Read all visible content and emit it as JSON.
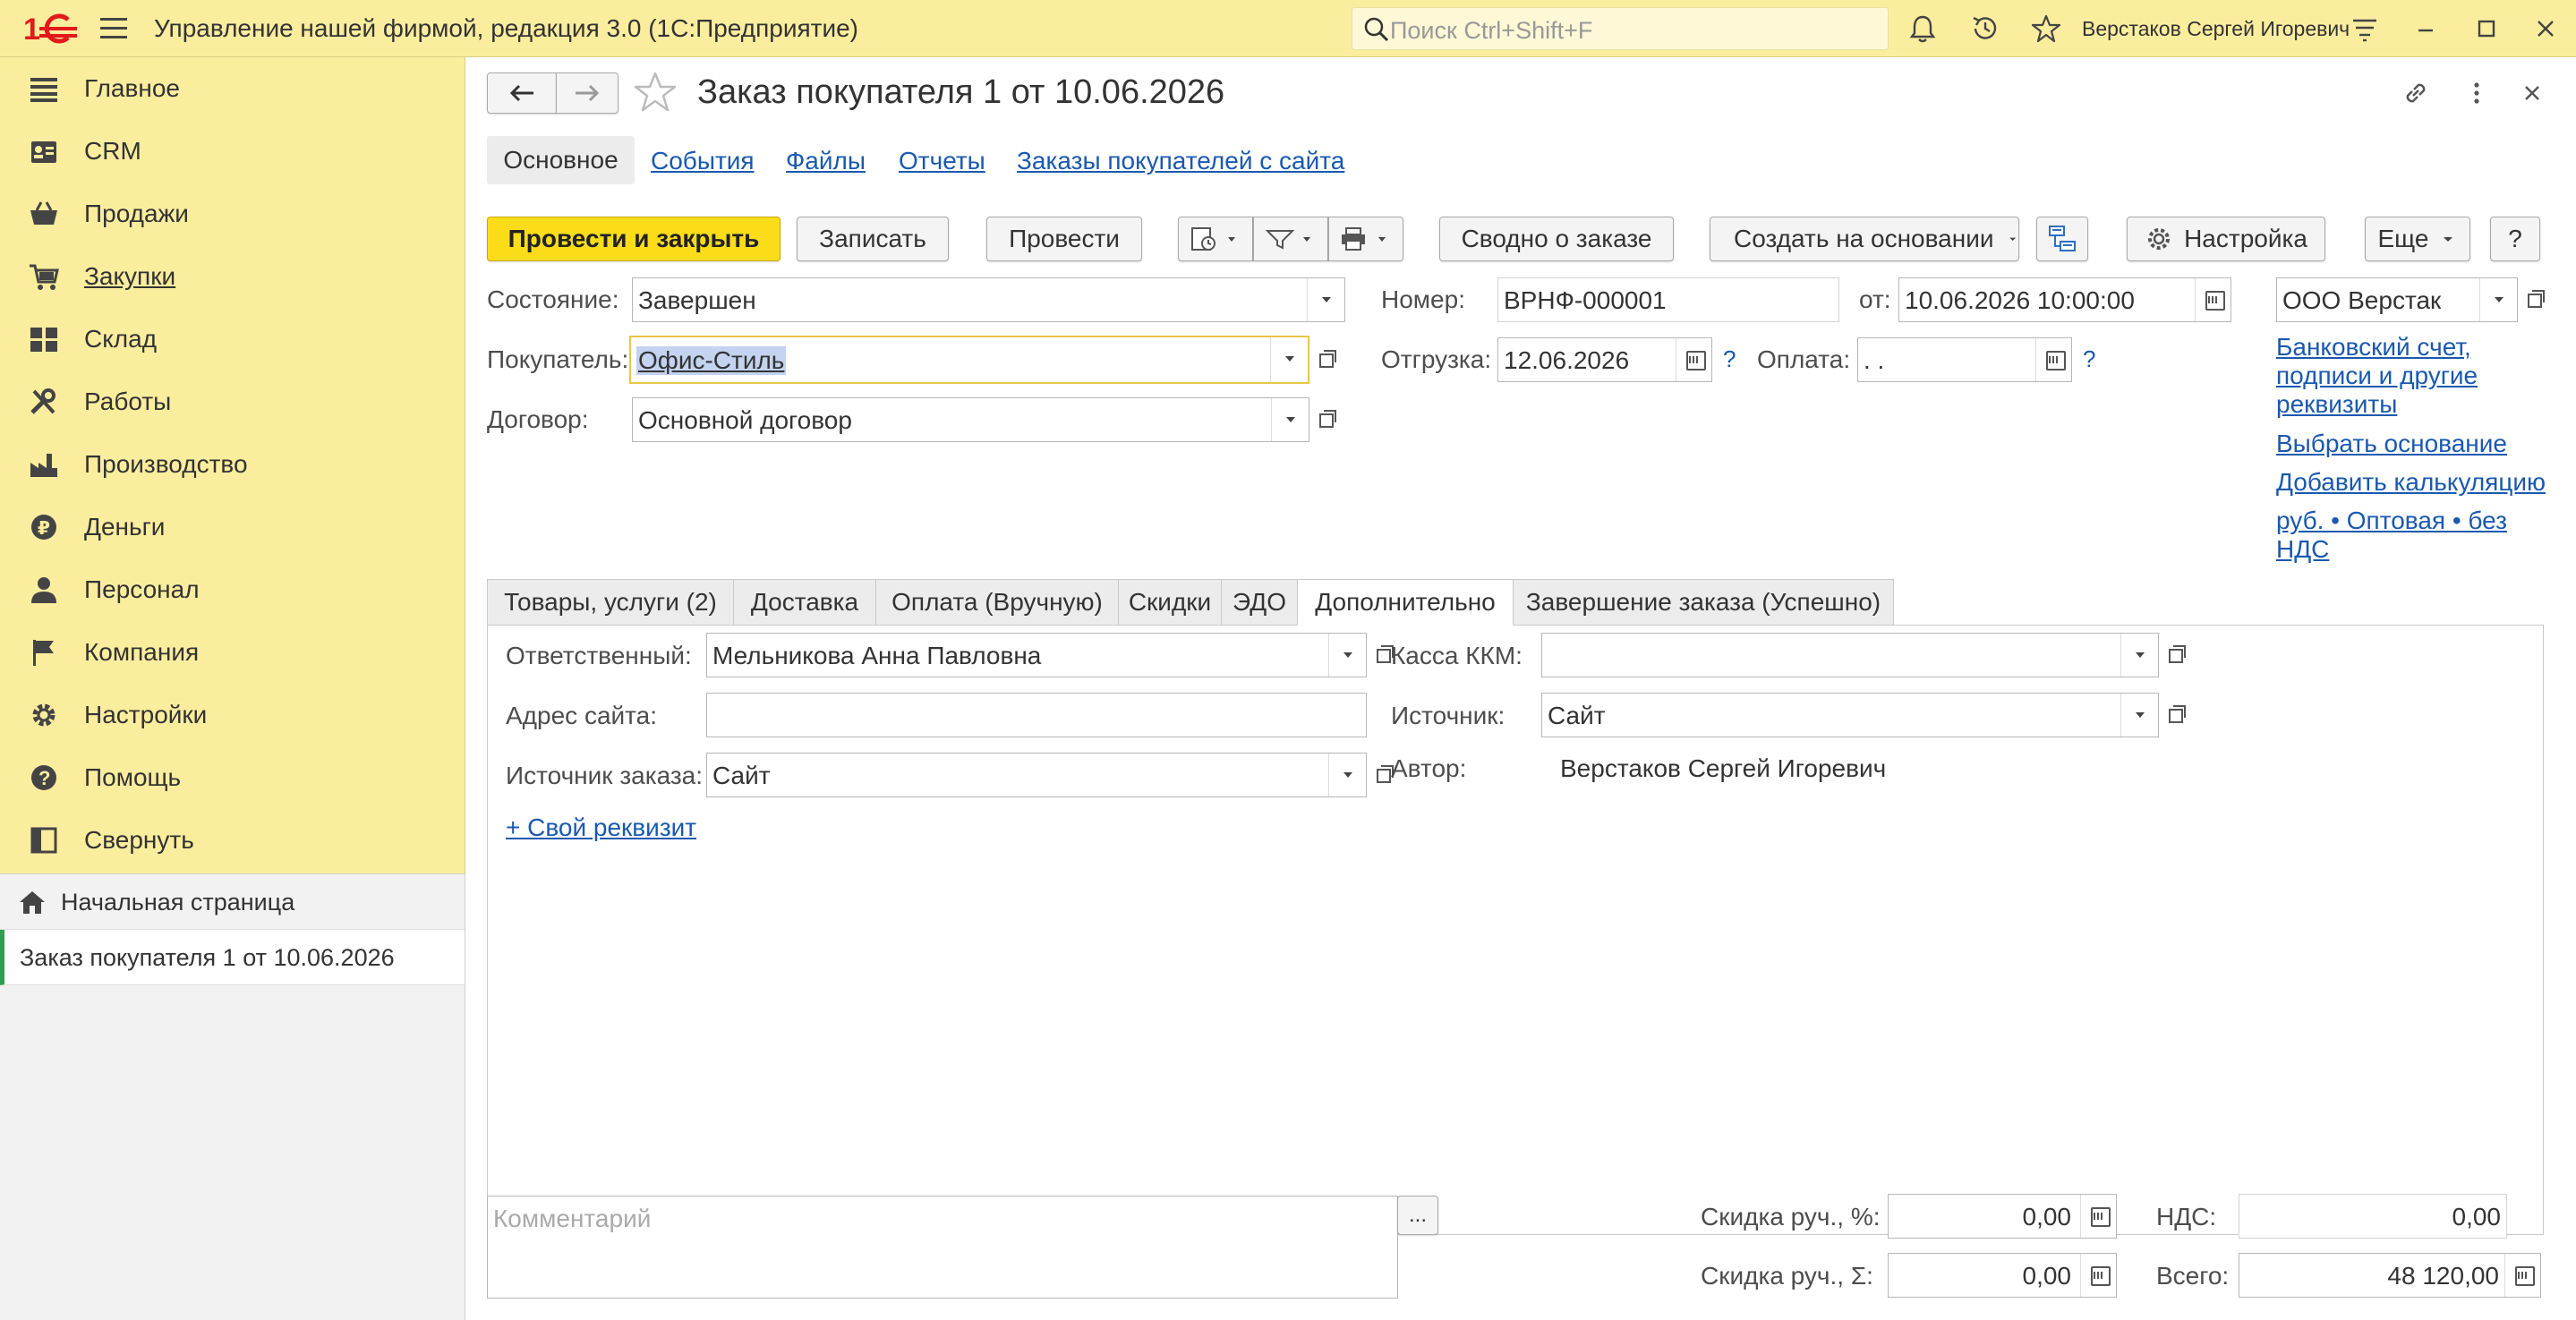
{
  "app": {
    "title": "Управление нашей фирмой, редакция 3.0  (1С:Предприятие)",
    "search_placeholder": "Поиск Ctrl+Shift+F",
    "user_name": "Верстаков Сергей Игоревич",
    "brand_color": "#e21a1a",
    "panel_color": "#fbed9e"
  },
  "sidebar": {
    "items": [
      {
        "label": "Главное",
        "icon": "list-icon"
      },
      {
        "label": "CRM",
        "icon": "contact-card-icon"
      },
      {
        "label": "Продажи",
        "icon": "basket-icon"
      },
      {
        "label": "Закупки",
        "icon": "cart-icon"
      },
      {
        "label": "Склад",
        "icon": "warehouse-icon"
      },
      {
        "label": "Работы",
        "icon": "tools-icon"
      },
      {
        "label": "Производство",
        "icon": "factory-icon"
      },
      {
        "label": "Деньги",
        "icon": "ruble-icon"
      },
      {
        "label": "Персонал",
        "icon": "person-icon"
      },
      {
        "label": "Компания",
        "icon": "flag-icon"
      },
      {
        "label": "Настройки",
        "icon": "gear-icon"
      },
      {
        "label": "Помощь",
        "icon": "help-icon"
      },
      {
        "label": "Свернуть",
        "icon": "collapse-panel-icon"
      }
    ],
    "home_label": "Начальная страница",
    "open_doc_label": "Заказ покупателя 1 от 10.06.2026"
  },
  "document": {
    "title": "Заказ покупателя 1 от 10.06.2026",
    "nav_tabs": [
      "Основное",
      "События",
      "Файлы",
      "Отчеты",
      "Заказы покупателей с сайта"
    ],
    "toolbar": {
      "post_close": "Провести и закрыть",
      "save": "Записать",
      "post": "Провести",
      "summary": "Сводно о заказе",
      "create_based": "Создать на основании",
      "settings": "Настройка",
      "more": "Еще",
      "help": "?"
    },
    "header": {
      "state_label": "Состояние:",
      "state_value": "Завершен",
      "customer_label": "Покупатель:",
      "customer_value": "Офис-Стиль",
      "contract_label": "Договор:",
      "contract_value": "Основной договор",
      "number_label": "Номер:",
      "number_value": "ВРНФ-000001",
      "date_label": "от:",
      "date_value": "10.06.2026 10:00:00",
      "shipment_label": "Отгрузка:",
      "shipment_value": "12.06.2026",
      "payment_label": "Оплата:",
      "payment_value": " .  .",
      "org_value": "ООО Верстак",
      "link_bank": "Банковский счет, подписи и другие реквизиты",
      "link_basis": "Выбрать основание",
      "link_calc": "Добавить калькуляцию",
      "link_price": "руб. • Оптовая • без НДС"
    },
    "tabs": [
      "Товары, услуги (2)",
      "Доставка",
      "Оплата (Вручную)",
      "Скидки",
      "ЭДО",
      "Дополнительно",
      "Завершение заказа (Успешно)"
    ],
    "active_tab": "Дополнительно",
    "extra": {
      "responsible_label": "Ответственный:",
      "responsible_value": "Мельникова Анна Павловна",
      "site_label": "Адрес сайта:",
      "site_value": "",
      "order_source_label": "Источник заказа:",
      "order_source_value": "Сайт",
      "custom_attr_link": "+ Свой реквизит",
      "kkm_label": "Касса ККМ:",
      "kkm_value": "",
      "source_label": "Источник:",
      "source_value": "Сайт",
      "author_label": "Автор:",
      "author_value": "Верстаков Сергей Игоревич"
    },
    "footer": {
      "comment_placeholder": "Комментарий",
      "ellipsis": "...",
      "discount_pct_label": "Скидка руч., %:",
      "discount_pct_value": "0,00",
      "discount_sum_label": "Скидка руч., Σ:",
      "discount_sum_value": "0,00",
      "vat_label": "НДС:",
      "vat_value": "0,00",
      "total_label": "Всего:",
      "total_value": "48 120,00"
    }
  }
}
